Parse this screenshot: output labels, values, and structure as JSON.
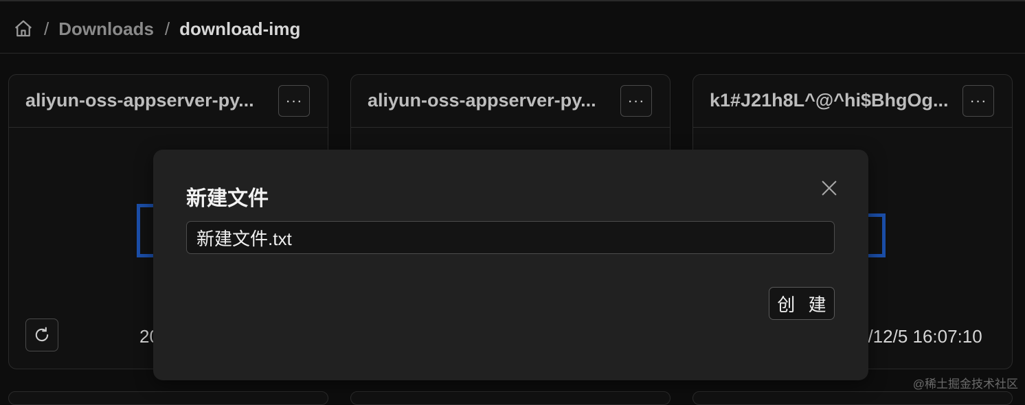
{
  "breadcrumb": {
    "home_icon": "home-icon",
    "separator": "/",
    "items": [
      {
        "label": "Downloads"
      },
      {
        "label": "download-img"
      }
    ]
  },
  "cards": [
    {
      "title": "aliyun-oss-appserver-py...",
      "more_label": "···",
      "date": "20"
    },
    {
      "title": "aliyun-oss-appserver-py...",
      "more_label": "···"
    },
    {
      "title": "k1#J21h8L^@^hi$BhgOg...",
      "more_label": "···",
      "date": "3/12/5 16:07:10"
    }
  ],
  "modal": {
    "title": "新建文件",
    "input_value": "新建文件.txt",
    "create_label": "创 建",
    "close_icon": "close-icon"
  },
  "watermark": "@稀土掘金技术社区",
  "colors": {
    "background": "#0d0d0d",
    "card": "#111111",
    "modal": "#212121",
    "accent": "#1b4ea8"
  }
}
